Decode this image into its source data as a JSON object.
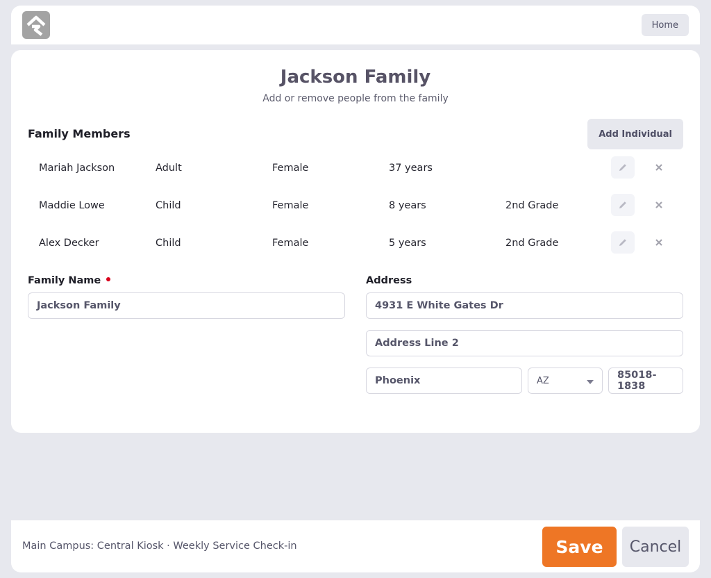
{
  "header": {
    "logo_icon": "rock-logo-icon",
    "home_label": "Home"
  },
  "main": {
    "title": "Jackson Family",
    "subtitle": "Add or remove people from the family",
    "members_heading": "Family Members",
    "add_individual_label": "Add Individual",
    "members": [
      {
        "name": "Mariah Jackson",
        "role": "Adult",
        "gender": "Female",
        "age": "37 years",
        "grade": ""
      },
      {
        "name": "Maddie Lowe",
        "role": "Child",
        "gender": "Female",
        "age": "8 years",
        "grade": "2nd Grade"
      },
      {
        "name": "Alex Decker",
        "role": "Child",
        "gender": "Female",
        "age": "5 years",
        "grade": "2nd Grade"
      }
    ],
    "row_icons": {
      "edit": "pencil-icon",
      "remove": "close-icon"
    }
  },
  "form": {
    "family_name_label": "Family Name",
    "family_name_required": true,
    "family_name_value": "Jackson Family",
    "address_label": "Address",
    "address_line1_value": "4931 E White Gates Dr",
    "address_line2_placeholder": "Address Line 2",
    "city_value": "Phoenix",
    "state_value": "AZ",
    "zip_value": "85018-1838"
  },
  "colors": {
    "accent": "#ee7625",
    "required": "#d9001b",
    "background": "#e7e8ee"
  },
  "footer": {
    "status_text": "Main Campus: Central Kiosk · Weekly Service Check-in",
    "save_label": "Save",
    "cancel_label": "Cancel"
  }
}
